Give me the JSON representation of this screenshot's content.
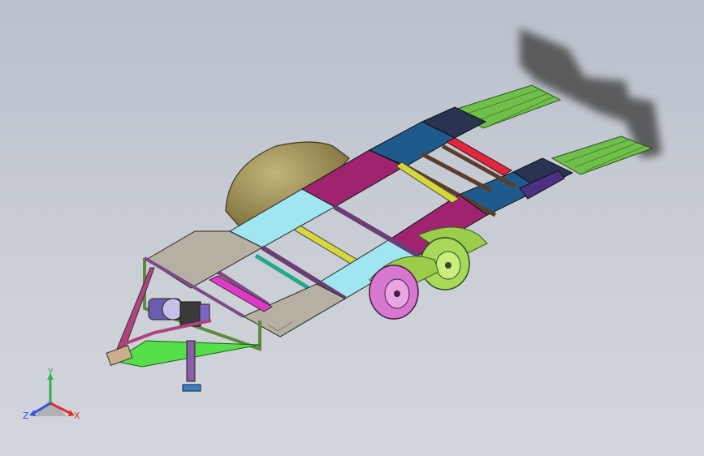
{
  "viewport": {
    "background_top": "#b9c0cb",
    "background_bottom": "#d3d6dc"
  },
  "model": {
    "parts": {
      "deck_panel_gray": "#b6b0a2",
      "deck_panel_cyan": "#9fe6f0",
      "deck_panel_magenta": "#a0236f",
      "deck_panel_blue": "#1f5a8c",
      "deck_panel_navy": "#2a3350",
      "ramp_green": "#6fbf4a",
      "fender_green": "#9ccc4c",
      "tire_magenta": "#d778d0",
      "tire_green": "#a8d95a",
      "fuel_tank": "#9e8d55",
      "crossmember_yellow": "#d6d83a",
      "crossmember_red": "#e0283c",
      "tongue_green": "#55e04a",
      "frame_purple": "#7d4a86",
      "jack_blue": "#3b7cc9"
    }
  },
  "triad": {
    "x_label": "X",
    "y_label": "Y",
    "z_label": "Z",
    "x_color": "#e32b2b",
    "y_color": "#2fb34a",
    "z_color": "#2a55d9"
  }
}
